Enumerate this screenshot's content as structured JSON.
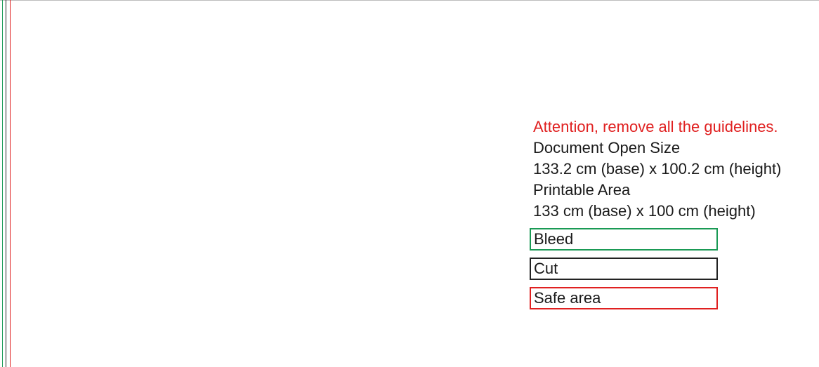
{
  "colors": {
    "bleed": "#1a9a55",
    "cut": "#222222",
    "safe_area": "#e02020",
    "warning_text": "#e02020"
  },
  "info": {
    "warning": "Attention, remove all the guidelines.",
    "document_open_size_label": "Document Open Size",
    "document_open_size_value": "133.2 cm (base) x 100.2 cm (height)",
    "printable_area_label": "Printable Area",
    "printable_area_value": "133 cm (base) x 100 cm (height)"
  },
  "legend": {
    "bleed": "Bleed",
    "cut": "Cut",
    "safe_area": "Safe area"
  }
}
